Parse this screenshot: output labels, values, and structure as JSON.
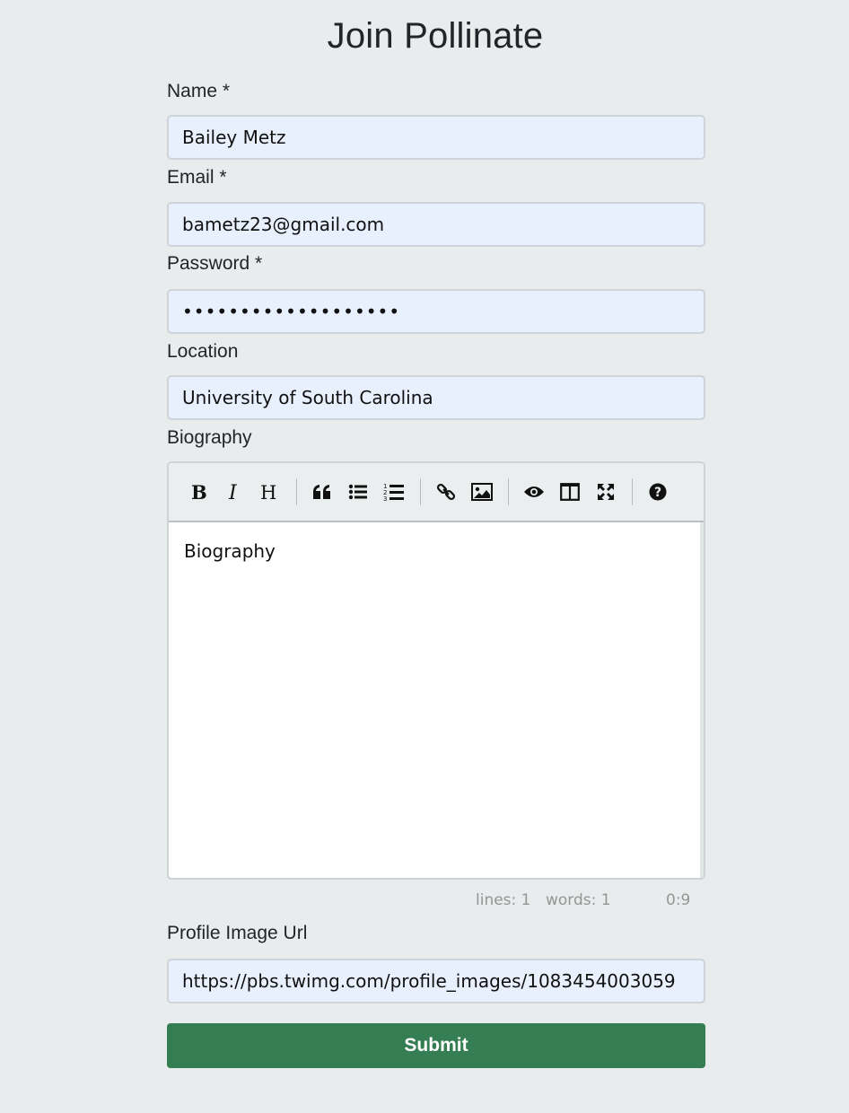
{
  "page": {
    "title": "Join Pollinate"
  },
  "form": {
    "name": {
      "label": "Name *",
      "value": "Bailey Metz"
    },
    "email": {
      "label": "Email *",
      "value": "bametz23@gmail.com"
    },
    "password": {
      "label": "Password *",
      "value": "•••••••••••••••••••"
    },
    "location": {
      "label": "Location",
      "value": "University of South Carolina"
    },
    "biography": {
      "label": "Biography",
      "content": "Biography",
      "toolbar": [
        "bold-icon",
        "italic-icon",
        "heading-icon",
        "quote-icon",
        "unordered-list-icon",
        "ordered-list-icon",
        "link-icon",
        "image-icon",
        "preview-icon",
        "side-by-side-icon",
        "fullscreen-icon",
        "help-icon"
      ],
      "status": {
        "lines": "lines: 1",
        "words": "words: 1",
        "cursor": "0:9"
      }
    },
    "profile_image": {
      "label": "Profile Image Url",
      "value": "https://pbs.twimg.com/profile_images/1083454003059"
    },
    "submit_label": "Submit"
  },
  "colors": {
    "background": "#e8ecec",
    "input_fill": "#e8f0fe",
    "submit": "#357d52"
  }
}
